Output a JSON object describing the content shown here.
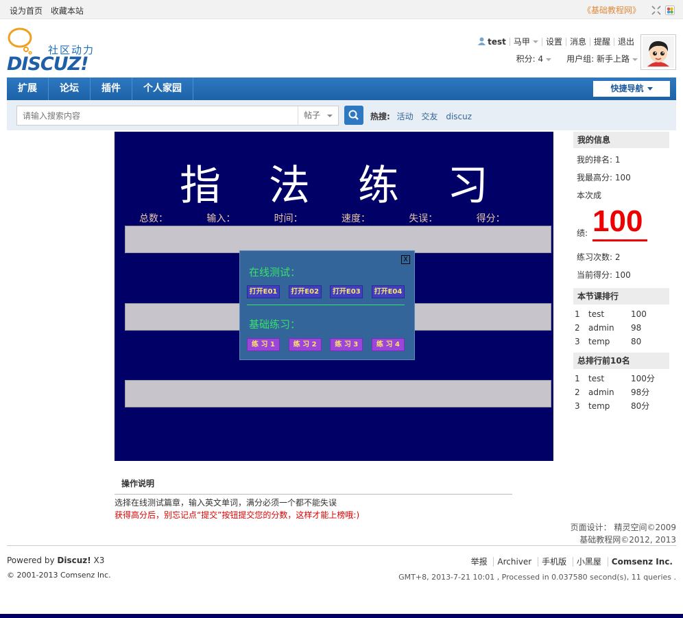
{
  "topbar": {
    "set_home": "设为首页",
    "bookmark": "收藏本站",
    "site_link": "《基础教程网》"
  },
  "logo": {
    "brand": "DISCUZ!",
    "sub": "社区动力"
  },
  "user": {
    "name": "test",
    "menu": [
      "马甲",
      "设置",
      "消息",
      "提醒",
      "退出"
    ],
    "points_label": "积分: 4",
    "group_label": "用户组: 新手上路"
  },
  "nav": {
    "items": [
      "扩展",
      "论坛",
      "插件",
      "个人家园"
    ],
    "quick": "快捷导航"
  },
  "search": {
    "placeholder": "请输入搜索内容",
    "type": "帖子",
    "hot_label": "热搜:",
    "hot": [
      "活动",
      "交友",
      "discuz"
    ]
  },
  "stage": {
    "title": "指法练习",
    "stats": [
      "总数：",
      "输入：",
      "时间：",
      "速度：",
      "失误：",
      "得分："
    ],
    "dialog": {
      "close": "X",
      "online_title": "在线测试：",
      "open_buttons": [
        "打开E01",
        "打开E02",
        "打开E03",
        "打开E04"
      ],
      "basic_title": "基础练习：",
      "practice_buttons": [
        "练 习 1",
        "练 习 2",
        "练 习 3",
        "练 习 4"
      ]
    }
  },
  "side": {
    "my_info": "我的信息",
    "rank": "我的排名: 1",
    "best": "我最高分: 100",
    "this_time": "本次成",
    "score_label": "绩:",
    "score": "100",
    "count": "练习次数: 2",
    "current": "当前得分: 100",
    "lesson_title": "本节课排行",
    "lesson_rank": [
      {
        "n": "1",
        "name": "test",
        "score": "100"
      },
      {
        "n": "2",
        "name": "admin",
        "score": "98"
      },
      {
        "n": "3",
        "name": "temp",
        "score": "80"
      }
    ],
    "top_title": "总排行前10名",
    "top_rank": [
      {
        "n": "1",
        "name": "test",
        "score": "100分"
      },
      {
        "n": "2",
        "name": "admin",
        "score": "98分"
      },
      {
        "n": "3",
        "name": "temp",
        "score": "80分"
      }
    ]
  },
  "instructions": {
    "title": "操作说明",
    "line1": "选择在线测试篇章，输入英文单词，满分必须一个都不能失误",
    "line2": "获得高分后，别忘记点“提交”按钮提交您的分数，这样才能上榜哦:)"
  },
  "credit": {
    "line1": "页面设计：  精灵空间©2009",
    "line2": "基础教程网©2012, 2013"
  },
  "footer": {
    "powered_prefix": "Powered by ",
    "powered_brand": "Discuz!",
    "powered_ver": " X3",
    "copyright": "© 2001-2013 Comsenz Inc.",
    "links": [
      "举报",
      "Archiver",
      "手机版",
      "小黑屋",
      "Comsenz Inc."
    ],
    "info": "GMT+8, 2013-7-21 10:01 , Processed in 0.037580 second(s), 11 queries ."
  }
}
